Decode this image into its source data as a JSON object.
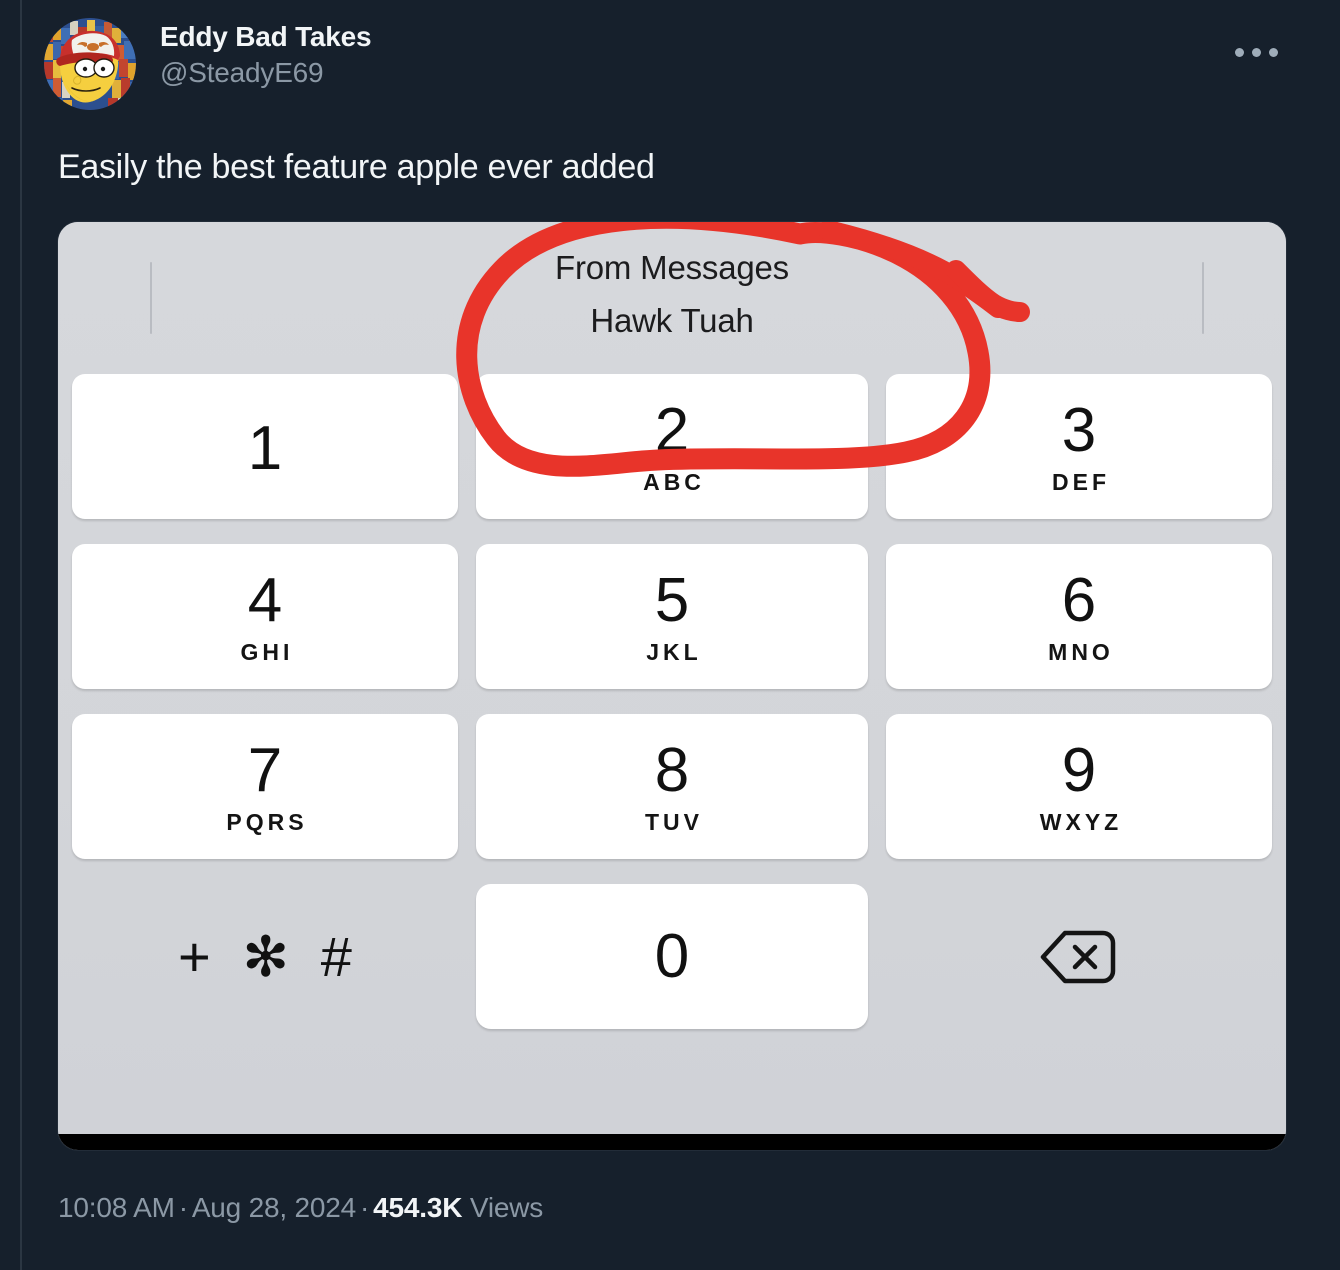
{
  "post": {
    "display_name": "Eddy Bad Takes",
    "handle": "@SteadyE69",
    "text": "Easily the best feature apple ever added",
    "more_menu_icon": "more-horizontal-icon",
    "avatar_alt": "cartoon-character-avatar"
  },
  "media": {
    "type": "screenshot",
    "app": "iOS Phone keypad",
    "caller": {
      "source_label": "From Messages",
      "name": "Hawk Tuah"
    },
    "annotation": {
      "shape": "hand-drawn-circle",
      "color": "#e8342a",
      "targets": "caller info and key 2"
    },
    "keypad": {
      "keys": [
        {
          "digit": "1",
          "letters": ""
        },
        {
          "digit": "2",
          "letters": "ABC"
        },
        {
          "digit": "3",
          "letters": "DEF"
        },
        {
          "digit": "4",
          "letters": "GHI"
        },
        {
          "digit": "5",
          "letters": "JKL"
        },
        {
          "digit": "6",
          "letters": "MNO"
        },
        {
          "digit": "7",
          "letters": "PQRS"
        },
        {
          "digit": "8",
          "letters": "TUV"
        },
        {
          "digit": "9",
          "letters": "WXYZ"
        }
      ],
      "symbols_key": "+ ✻ #",
      "zero_key": "0",
      "delete_icon": "backspace-delete-icon"
    }
  },
  "footer": {
    "time": "10:08 AM",
    "separator": "·",
    "date": "Aug 28, 2024",
    "views_count": "454.3K",
    "views_label": "Views"
  },
  "colors": {
    "background": "#16202c",
    "text_primary": "#f2f5f7",
    "text_secondary": "#8b98a5",
    "annotation_red": "#e8342a",
    "keypad_surface": "#d4d6da",
    "key_white": "#ffffff"
  }
}
